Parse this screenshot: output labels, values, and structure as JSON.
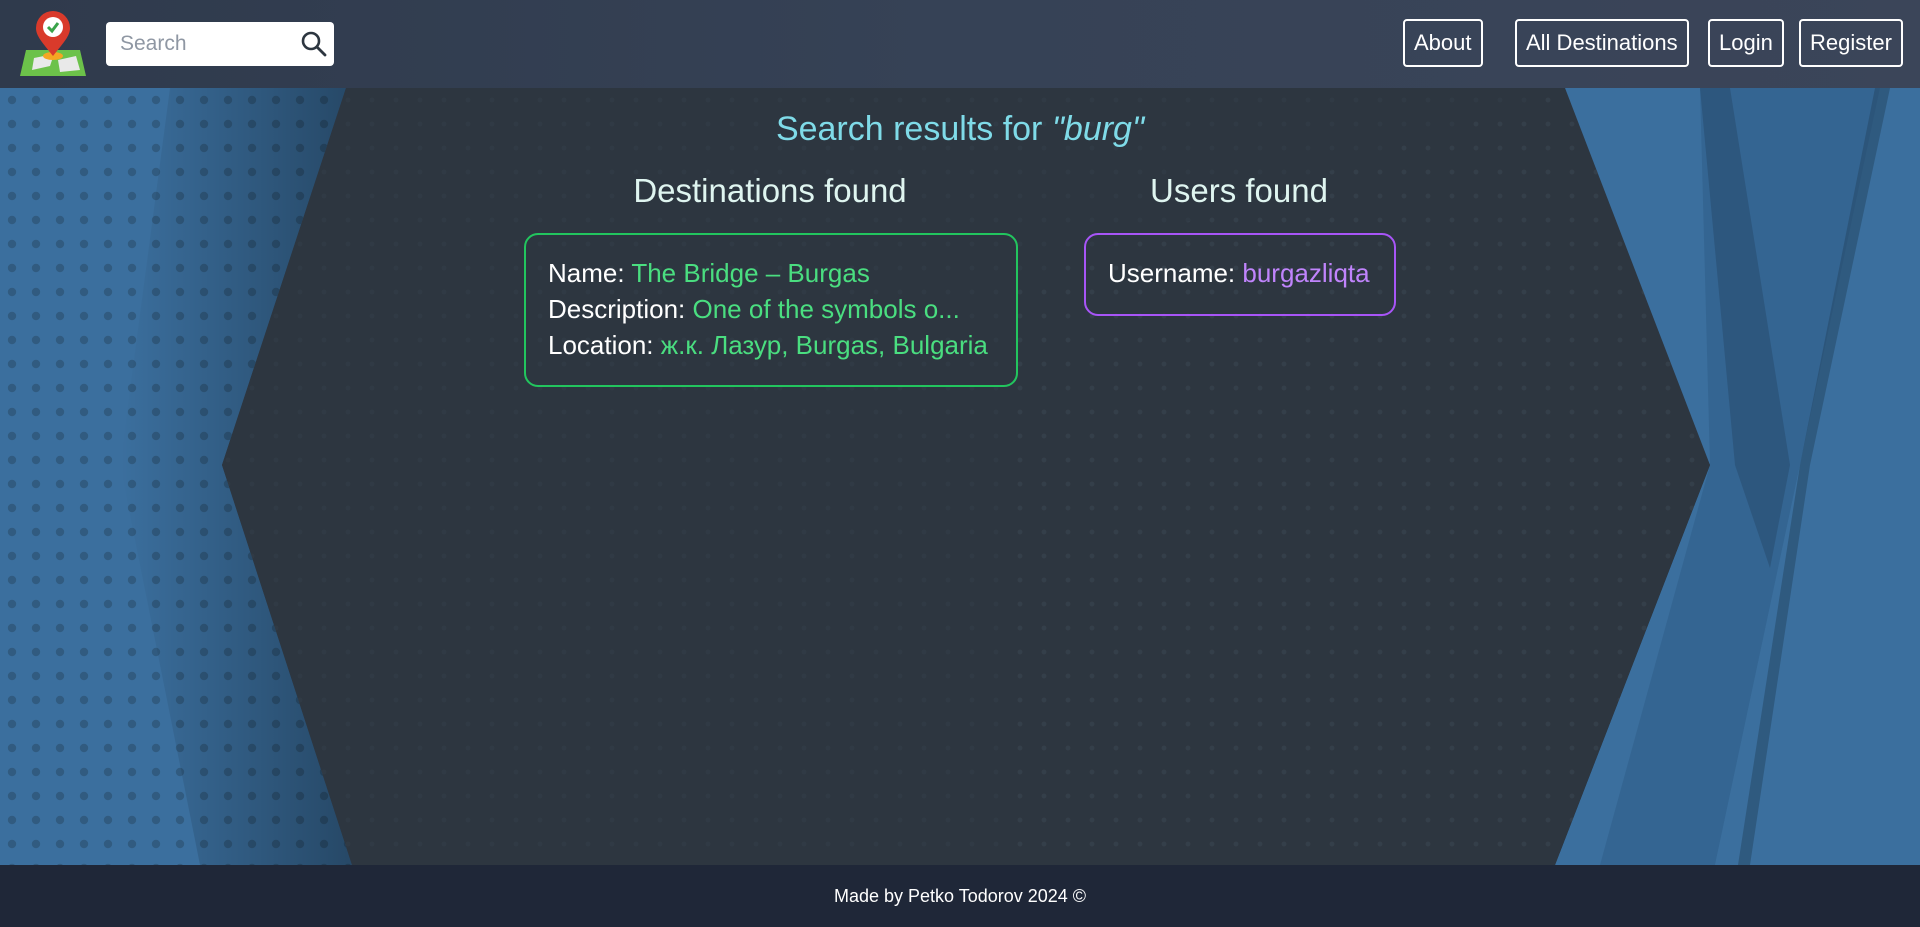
{
  "header": {
    "search_placeholder": "Search",
    "nav": {
      "about": "About",
      "all_destinations": "All Destinations",
      "login": "Login",
      "register": "Register"
    }
  },
  "main": {
    "results_prefix": "Search results for",
    "query": "\"burg\"",
    "destinations_title": "Destinations found",
    "users_title": "Users found",
    "destination": {
      "name_label": "Name: ",
      "name_value": "The Bridge – Burgas",
      "description_label": "Description: ",
      "description_value": "One of the symbols o...",
      "location_label": "Location: ",
      "location_value": "ж.к. Лазур, Burgas, Bulgaria"
    },
    "user": {
      "username_label": "Username: ",
      "username_value": "burgazliqta"
    }
  },
  "footer": {
    "text": "Made by Petko Todorov 2024 ©"
  },
  "colors": {
    "accent_blue": "#3b6f9e",
    "destination_green": "#22c55e",
    "user_purple": "#a855f7",
    "title_cyan": "#7fdbe8"
  }
}
